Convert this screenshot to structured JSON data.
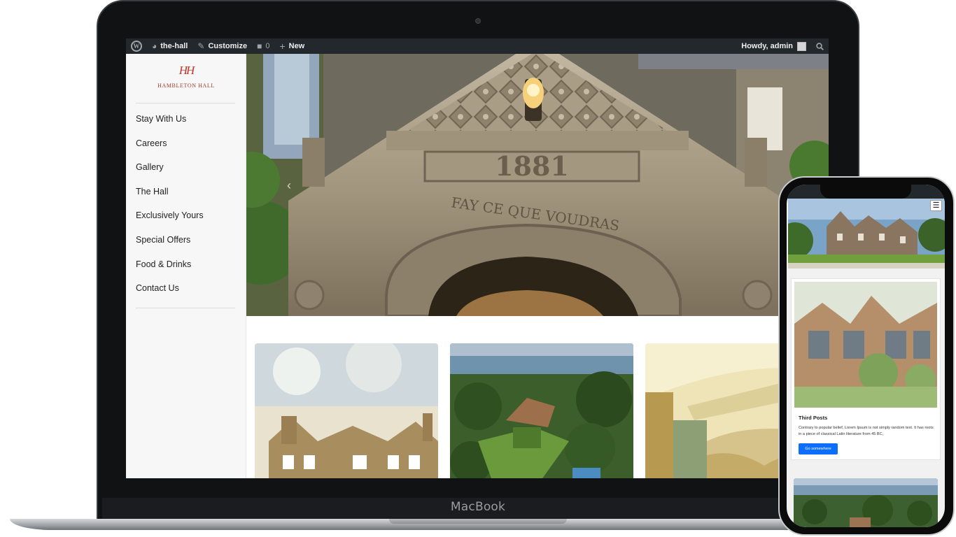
{
  "device": {
    "laptop_label": "MacBook"
  },
  "admin_bar": {
    "site_name": "the-hall",
    "customize_label": "Customize",
    "comments_count": "0",
    "new_label": "New",
    "greeting": "Howdy, admin"
  },
  "sidebar": {
    "logo_monogram": "HH",
    "logo_text": "HAMBLETON HALL",
    "nav": [
      {
        "label": "Stay With Us"
      },
      {
        "label": "Careers"
      },
      {
        "label": "Gallery"
      },
      {
        "label": "The Hall"
      },
      {
        "label": "Exclusively Yours"
      },
      {
        "label": "Special Offers"
      },
      {
        "label": "Food & Drinks"
      },
      {
        "label": "Contact Us"
      }
    ]
  },
  "hero": {
    "date_carving": "1881",
    "motto_carving": "FAY CE QUE VOUDRAS"
  },
  "phone": {
    "card": {
      "title": "Third Posts",
      "text": "Contrary to popular belief, Lorem Ipsum is not simply random text. It has roots in a piece of classical Latin literature from 45 BC,",
      "button": "Go somewhere"
    }
  },
  "colors": {
    "admin_bar": "#23282d",
    "logo_red": "#a4372b",
    "button_blue": "#0d6efd"
  }
}
